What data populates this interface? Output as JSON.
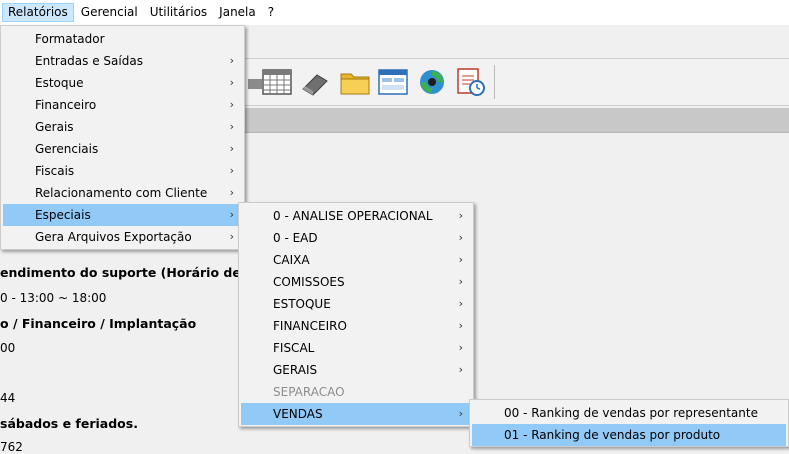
{
  "menubar": {
    "items": [
      {
        "label": "Relatórios"
      },
      {
        "label": "Gerencial"
      },
      {
        "label": "Utilitários"
      },
      {
        "label": "Janela"
      },
      {
        "label": "?"
      }
    ]
  },
  "background": {
    "lines": [
      "endimento do suporte (Horário de Brasíl",
      "0 - 13:00 ~ 18:00",
      "o / Financeiro / Implantação",
      "00",
      "44",
      "sábados e feriados.",
      "762"
    ]
  },
  "menu_relatorios": {
    "items": [
      {
        "label": "Formatador"
      },
      {
        "label": "Entradas e Saídas"
      },
      {
        "label": "Estoque"
      },
      {
        "label": "Financeiro"
      },
      {
        "label": "Gerais"
      },
      {
        "label": "Gerenciais"
      },
      {
        "label": "Fiscais"
      },
      {
        "label": "Relacionamento com Cliente"
      },
      {
        "label": "Especiais"
      },
      {
        "label": "Gera Arquivos Exportação"
      }
    ]
  },
  "menu_especiais": {
    "items": [
      {
        "label": "0 - ANALISE OPERACIONAL"
      },
      {
        "label": "0 - EAD"
      },
      {
        "label": "CAIXA"
      },
      {
        "label": "COMISSOES"
      },
      {
        "label": "ESTOQUE"
      },
      {
        "label": "FINANCEIRO"
      },
      {
        "label": "FISCAL"
      },
      {
        "label": "GERAIS"
      },
      {
        "label": "SEPARACAO"
      },
      {
        "label": "VENDAS"
      }
    ]
  },
  "menu_vendas": {
    "items": [
      {
        "label": "00 - Ranking de vendas por representante"
      },
      {
        "label": "01 - Ranking de vendas por produto"
      }
    ]
  },
  "submenu_arrow": "›"
}
